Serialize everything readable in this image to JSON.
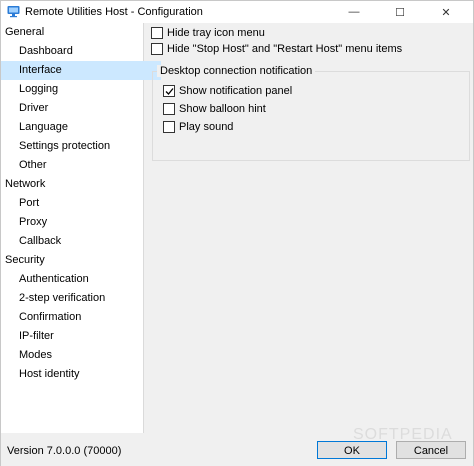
{
  "window": {
    "title": "Remote Utilities Host - Configuration",
    "controls": {
      "minimize": "—",
      "maximize": "☐",
      "close": "✕"
    }
  },
  "sidebar": {
    "items": [
      {
        "label": "General",
        "type": "category"
      },
      {
        "label": "Dashboard",
        "type": "sub"
      },
      {
        "label": "Interface",
        "type": "sub",
        "selected": true
      },
      {
        "label": "Logging",
        "type": "sub"
      },
      {
        "label": "Driver",
        "type": "sub"
      },
      {
        "label": "Language",
        "type": "sub"
      },
      {
        "label": "Settings protection",
        "type": "sub"
      },
      {
        "label": "Other",
        "type": "sub"
      },
      {
        "label": "Network",
        "type": "category"
      },
      {
        "label": "Port",
        "type": "sub"
      },
      {
        "label": "Proxy",
        "type": "sub"
      },
      {
        "label": "Callback",
        "type": "sub"
      },
      {
        "label": "Security",
        "type": "category"
      },
      {
        "label": "Authentication",
        "type": "sub"
      },
      {
        "label": "2-step verification",
        "type": "sub"
      },
      {
        "label": "Confirmation",
        "type": "sub"
      },
      {
        "label": "IP-filter",
        "type": "sub"
      },
      {
        "label": "Modes",
        "type": "sub"
      },
      {
        "label": "Host identity",
        "type": "sub"
      }
    ]
  },
  "content": {
    "hide_tray": {
      "label": "Hide tray icon menu",
      "checked": false
    },
    "hide_stop": {
      "label": "Hide \"Stop Host\" and \"Restart Host\" menu items",
      "checked": false
    },
    "notification_group": {
      "title": "Desktop connection notification",
      "show_panel": {
        "label": "Show notification panel",
        "checked": true
      },
      "show_balloon": {
        "label": "Show balloon hint",
        "checked": false
      },
      "play_sound": {
        "label": "Play sound",
        "checked": false
      }
    }
  },
  "footer": {
    "version": "Version 7.0.0.0 (70000)",
    "ok_label": "OK",
    "cancel_label": "Cancel"
  },
  "watermark": "SOFTPEDIA",
  "colors": {
    "selected": "#cce8ff",
    "accent": "#0078d7"
  }
}
